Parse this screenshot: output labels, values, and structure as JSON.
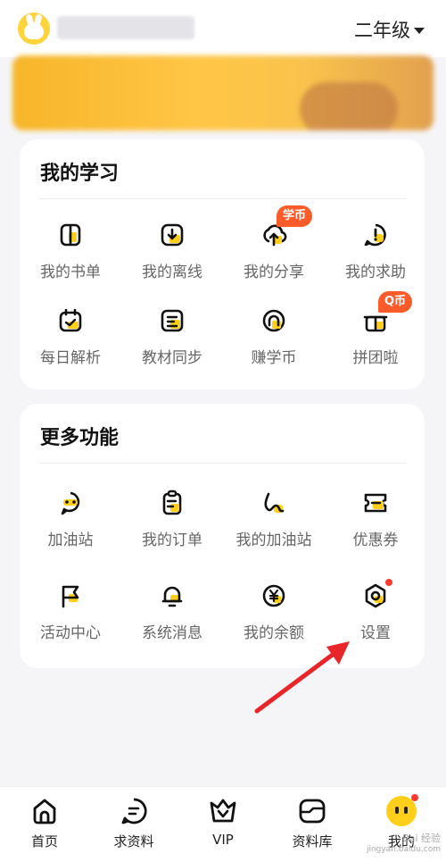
{
  "header": {
    "grade": "二年级"
  },
  "study": {
    "title": "我的学习",
    "items": [
      {
        "label": "我的书单",
        "icon": "book-icon"
      },
      {
        "label": "我的离线",
        "icon": "download-icon"
      },
      {
        "label": "我的分享",
        "icon": "share-upload-icon",
        "badge": "学币"
      },
      {
        "label": "我的求助",
        "icon": "help-bubble-icon"
      },
      {
        "label": "每日解析",
        "icon": "calendar-icon"
      },
      {
        "label": "教材同步",
        "icon": "textbook-icon"
      },
      {
        "label": "赚学币",
        "icon": "coin-arrow-icon"
      },
      {
        "label": "拼团啦",
        "icon": "gift-icon",
        "badge": "Q币"
      }
    ]
  },
  "more": {
    "title": "更多功能",
    "items": [
      {
        "label": "加油站",
        "icon": "chat-face-icon"
      },
      {
        "label": "我的订单",
        "icon": "clipboard-icon"
      },
      {
        "label": "我的加油站",
        "icon": "squiggle-icon"
      },
      {
        "label": "优惠券",
        "icon": "coupon-icon"
      },
      {
        "label": "活动中心",
        "icon": "flag-icon"
      },
      {
        "label": "系统消息",
        "icon": "bell-icon"
      },
      {
        "label": "我的余额",
        "icon": "yuan-icon"
      },
      {
        "label": "设置",
        "icon": "gear-icon"
      }
    ]
  },
  "tabbar": [
    {
      "label": "首页",
      "icon": "home-icon"
    },
    {
      "label": "求资料",
      "icon": "chat-request-icon"
    },
    {
      "label": "VIP",
      "icon": "crown-icon"
    },
    {
      "label": "资料库",
      "icon": "folder-icon"
    },
    {
      "label": "我的",
      "icon": "profile-face-icon"
    }
  ],
  "watermark": {
    "line1": "Bai 经验",
    "line2": "jingyan.baidu.com"
  },
  "colors": {
    "accent_yellow": "#ffcf1a",
    "badge_orange": "#ff5a2a",
    "arrow_red": "#e8262a"
  }
}
